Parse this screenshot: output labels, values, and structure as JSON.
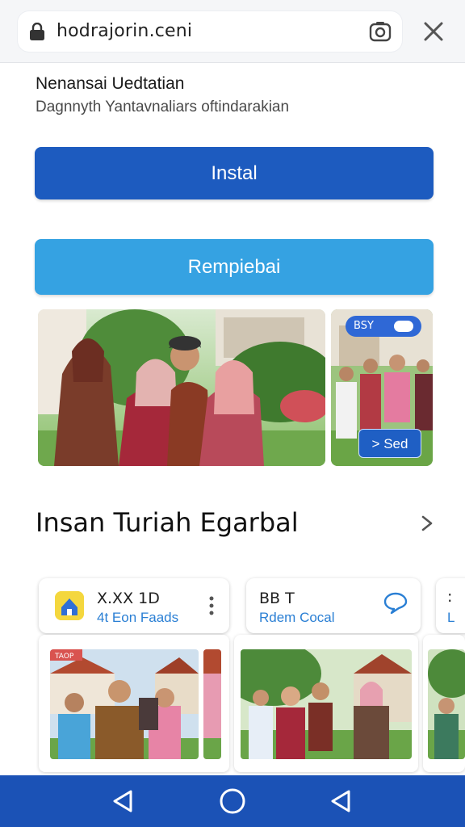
{
  "browser": {
    "url": "hodrajorin.ceni",
    "lock_icon": "lock-icon",
    "camera_icon": "camera-icon",
    "close_icon": "close-icon"
  },
  "app": {
    "title": "Nenansai Uedtatian",
    "subtitle": "Dagnnyth Yantavnaliars oftindarakian",
    "install_label": "Instal",
    "secondary_label": "Rempiebai"
  },
  "screenshots": {
    "badge_top": "BSY",
    "badge_bottom": "> Sed"
  },
  "section": {
    "title": "Insan Turiah Egarbal",
    "arrow_icon": "chevron-right-icon"
  },
  "related_apps": [
    {
      "title": "X.XX 1D",
      "subtitle": "4t Eon Faads",
      "icon": "house-app-icon"
    },
    {
      "title": "BB T",
      "subtitle": "Rdem Cocal",
      "icon": "chat-icon"
    },
    {
      "title": ":",
      "subtitle": "L"
    }
  ],
  "gallery": {
    "sign_text": "TAOP"
  },
  "navbar": {
    "back_icon": "back-triangle-icon",
    "home_icon": "home-circle-icon",
    "recent_icon": "back-triangle-icon"
  },
  "colors": {
    "install": "#1d5bbf",
    "secondary": "#35a2e2",
    "navbar": "#1b52b6",
    "link": "#2a7fd4"
  }
}
